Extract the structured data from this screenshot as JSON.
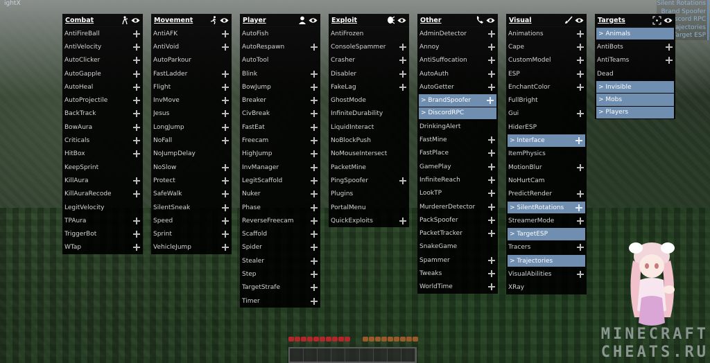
{
  "client_name": "ightX",
  "arraylist": [
    "Silent Rotations",
    "Brand Spoofer",
    "Discord RPC",
    "Trajectories",
    "Target ESP"
  ],
  "colors": {
    "panel_bg": "#000000",
    "active": "#6f8eb0",
    "text": "#d4d4d4"
  },
  "panels": [
    {
      "title": "Combat",
      "icon": "crosshair-person-icon",
      "items": [
        {
          "label": "AntiFireBall",
          "expandable": true
        },
        {
          "label": "AntiVelocity",
          "expandable": true
        },
        {
          "label": "AutoClicker",
          "expandable": true
        },
        {
          "label": "AutoGapple",
          "expandable": true
        },
        {
          "label": "AutoHeal",
          "expandable": true
        },
        {
          "label": "AutoProjectile",
          "expandable": true
        },
        {
          "label": "BackTrack",
          "expandable": true
        },
        {
          "label": "BowAura",
          "expandable": true
        },
        {
          "label": "Criticals",
          "expandable": true
        },
        {
          "label": "HitBox",
          "expandable": true
        },
        {
          "label": "KeepSprint",
          "expandable": false
        },
        {
          "label": "KillAura",
          "expandable": true
        },
        {
          "label": "KillAuraRecode",
          "expandable": true
        },
        {
          "label": "LegitVelocity",
          "expandable": false
        },
        {
          "label": "TPAura",
          "expandable": true
        },
        {
          "label": "TriggerBot",
          "expandable": true
        },
        {
          "label": "WTap",
          "expandable": true
        }
      ]
    },
    {
      "title": "Movement",
      "icon": "running-icon",
      "items": [
        {
          "label": "AntiAFK",
          "expandable": true
        },
        {
          "label": "AntiVoid",
          "expandable": true
        },
        {
          "label": "AutoParkour",
          "expandable": false
        },
        {
          "label": "FastLadder",
          "expandable": true
        },
        {
          "label": "Flight",
          "expandable": true
        },
        {
          "label": "InvMove",
          "expandable": true
        },
        {
          "label": "Jesus",
          "expandable": true
        },
        {
          "label": "LongJump",
          "expandable": true
        },
        {
          "label": "NoFall",
          "expandable": true
        },
        {
          "label": "NoJumpDelay",
          "expandable": false
        },
        {
          "label": "NoSlow",
          "expandable": true
        },
        {
          "label": "Protect",
          "expandable": true
        },
        {
          "label": "SafeWalk",
          "expandable": true
        },
        {
          "label": "SilentSneak",
          "expandable": true
        },
        {
          "label": "Speed",
          "expandable": true
        },
        {
          "label": "Sprint",
          "expandable": true
        },
        {
          "label": "VehicleJump",
          "expandable": true
        }
      ]
    },
    {
      "title": "Player",
      "icon": "user-icon",
      "items": [
        {
          "label": "AutoFish",
          "expandable": false
        },
        {
          "label": "AutoRespawn",
          "expandable": true
        },
        {
          "label": "AutoTool",
          "expandable": false
        },
        {
          "label": "Blink",
          "expandable": true
        },
        {
          "label": "BowJump",
          "expandable": true
        },
        {
          "label": "Breaker",
          "expandable": true
        },
        {
          "label": "CivBreak",
          "expandable": true
        },
        {
          "label": "FastEat",
          "expandable": true
        },
        {
          "label": "Freecam",
          "expandable": true
        },
        {
          "label": "HighJump",
          "expandable": true
        },
        {
          "label": "InvManager",
          "expandable": true
        },
        {
          "label": "LegitScaffold",
          "expandable": true
        },
        {
          "label": "Nuker",
          "expandable": true
        },
        {
          "label": "Phase",
          "expandable": true
        },
        {
          "label": "ReverseFreecam",
          "expandable": true
        },
        {
          "label": "Scaffold",
          "expandable": true
        },
        {
          "label": "Spider",
          "expandable": true
        },
        {
          "label": "Stealer",
          "expandable": true
        },
        {
          "label": "Step",
          "expandable": true
        },
        {
          "label": "TargetStrafe",
          "expandable": true
        },
        {
          "label": "Timer",
          "expandable": true
        }
      ]
    },
    {
      "title": "Exploit",
      "icon": "bug-icon",
      "items": [
        {
          "label": "AntiFrozen",
          "expandable": false
        },
        {
          "label": "ConsoleSpammer",
          "expandable": true
        },
        {
          "label": "Crasher",
          "expandable": true
        },
        {
          "label": "Disabler",
          "expandable": true
        },
        {
          "label": "FakeLag",
          "expandable": true
        },
        {
          "label": "GhostMode",
          "expandable": false
        },
        {
          "label": "InfiniteDurability",
          "expandable": false
        },
        {
          "label": "LiquidInteract",
          "expandable": false
        },
        {
          "label": "NoBlockPush",
          "expandable": false
        },
        {
          "label": "NoMouseIntersect",
          "expandable": false
        },
        {
          "label": "PacketMine",
          "expandable": false
        },
        {
          "label": "PingSpoofer",
          "expandable": true
        },
        {
          "label": "Plugins",
          "expandable": false
        },
        {
          "label": "PortalMenu",
          "expandable": false
        },
        {
          "label": "QuickExploits",
          "expandable": true
        }
      ]
    },
    {
      "title": "Other",
      "icon": "phone-icon",
      "items": [
        {
          "label": "AdminDetector",
          "expandable": true
        },
        {
          "label": "Annoy",
          "expandable": true
        },
        {
          "label": "AntiSuffocation",
          "expandable": true
        },
        {
          "label": "AutoAuth",
          "expandable": true
        },
        {
          "label": "AutoGetter",
          "expandable": true
        },
        {
          "label": "> BrandSpoofer",
          "expandable": true,
          "active": true
        },
        {
          "label": "> DiscordRPC",
          "expandable": false,
          "active": true
        },
        {
          "label": "DrinkingAlert",
          "expandable": false
        },
        {
          "label": "FastMine",
          "expandable": true
        },
        {
          "label": "FastPlace",
          "expandable": true
        },
        {
          "label": "GamePlay",
          "expandable": true
        },
        {
          "label": "InfiniteReach",
          "expandable": true
        },
        {
          "label": "LookTP",
          "expandable": true
        },
        {
          "label": "MurdererDetector",
          "expandable": true
        },
        {
          "label": "PackSpoofer",
          "expandable": true
        },
        {
          "label": "PacketTracker",
          "expandable": true
        },
        {
          "label": "SnakeGame",
          "expandable": false
        },
        {
          "label": "Spammer",
          "expandable": true
        },
        {
          "label": "Tweaks",
          "expandable": true
        },
        {
          "label": "WorldTime",
          "expandable": true
        }
      ]
    },
    {
      "title": "Visual",
      "icon": "brush-icon",
      "items": [
        {
          "label": "Animations",
          "expandable": true
        },
        {
          "label": "Cape",
          "expandable": true
        },
        {
          "label": "CustomModel",
          "expandable": true
        },
        {
          "label": "ESP",
          "expandable": true
        },
        {
          "label": "EnchantColor",
          "expandable": true
        },
        {
          "label": "FullBright",
          "expandable": false
        },
        {
          "label": "Gui",
          "expandable": true
        },
        {
          "label": "HiderESP",
          "expandable": false
        },
        {
          "label": "> Interface",
          "expandable": true,
          "active": true
        },
        {
          "label": "ItemPhysics",
          "expandable": false
        },
        {
          "label": "MotionBlur",
          "expandable": true
        },
        {
          "label": "NoHurtCam",
          "expandable": false
        },
        {
          "label": "PredictRender",
          "expandable": true
        },
        {
          "label": "> SilentRotations",
          "expandable": true,
          "active": true
        },
        {
          "label": "StreamerMode",
          "expandable": true
        },
        {
          "label": "> TargetESP",
          "expandable": false,
          "active": true
        },
        {
          "label": "Tracers",
          "expandable": true
        },
        {
          "label": "> Trajectories",
          "expandable": false,
          "active": true
        },
        {
          "label": "VisualAbilities",
          "expandable": true
        },
        {
          "label": "XRay",
          "expandable": false
        }
      ]
    },
    {
      "title": "Targets",
      "icon": "target-icon",
      "items": [
        {
          "label": "> Animals",
          "expandable": false,
          "active": true
        },
        {
          "label": "AntiBots",
          "expandable": true
        },
        {
          "label": "AntiTeams",
          "expandable": true
        },
        {
          "label": "Dead",
          "expandable": false
        },
        {
          "label": "> Invisible",
          "expandable": false,
          "active": true
        },
        {
          "label": "> Mobs",
          "expandable": false,
          "active": true
        },
        {
          "label": "> Players",
          "expandable": false,
          "active": true
        }
      ]
    }
  ],
  "watermark": {
    "line1": "MINECRAFT",
    "line2": "CHEATS.RU"
  }
}
